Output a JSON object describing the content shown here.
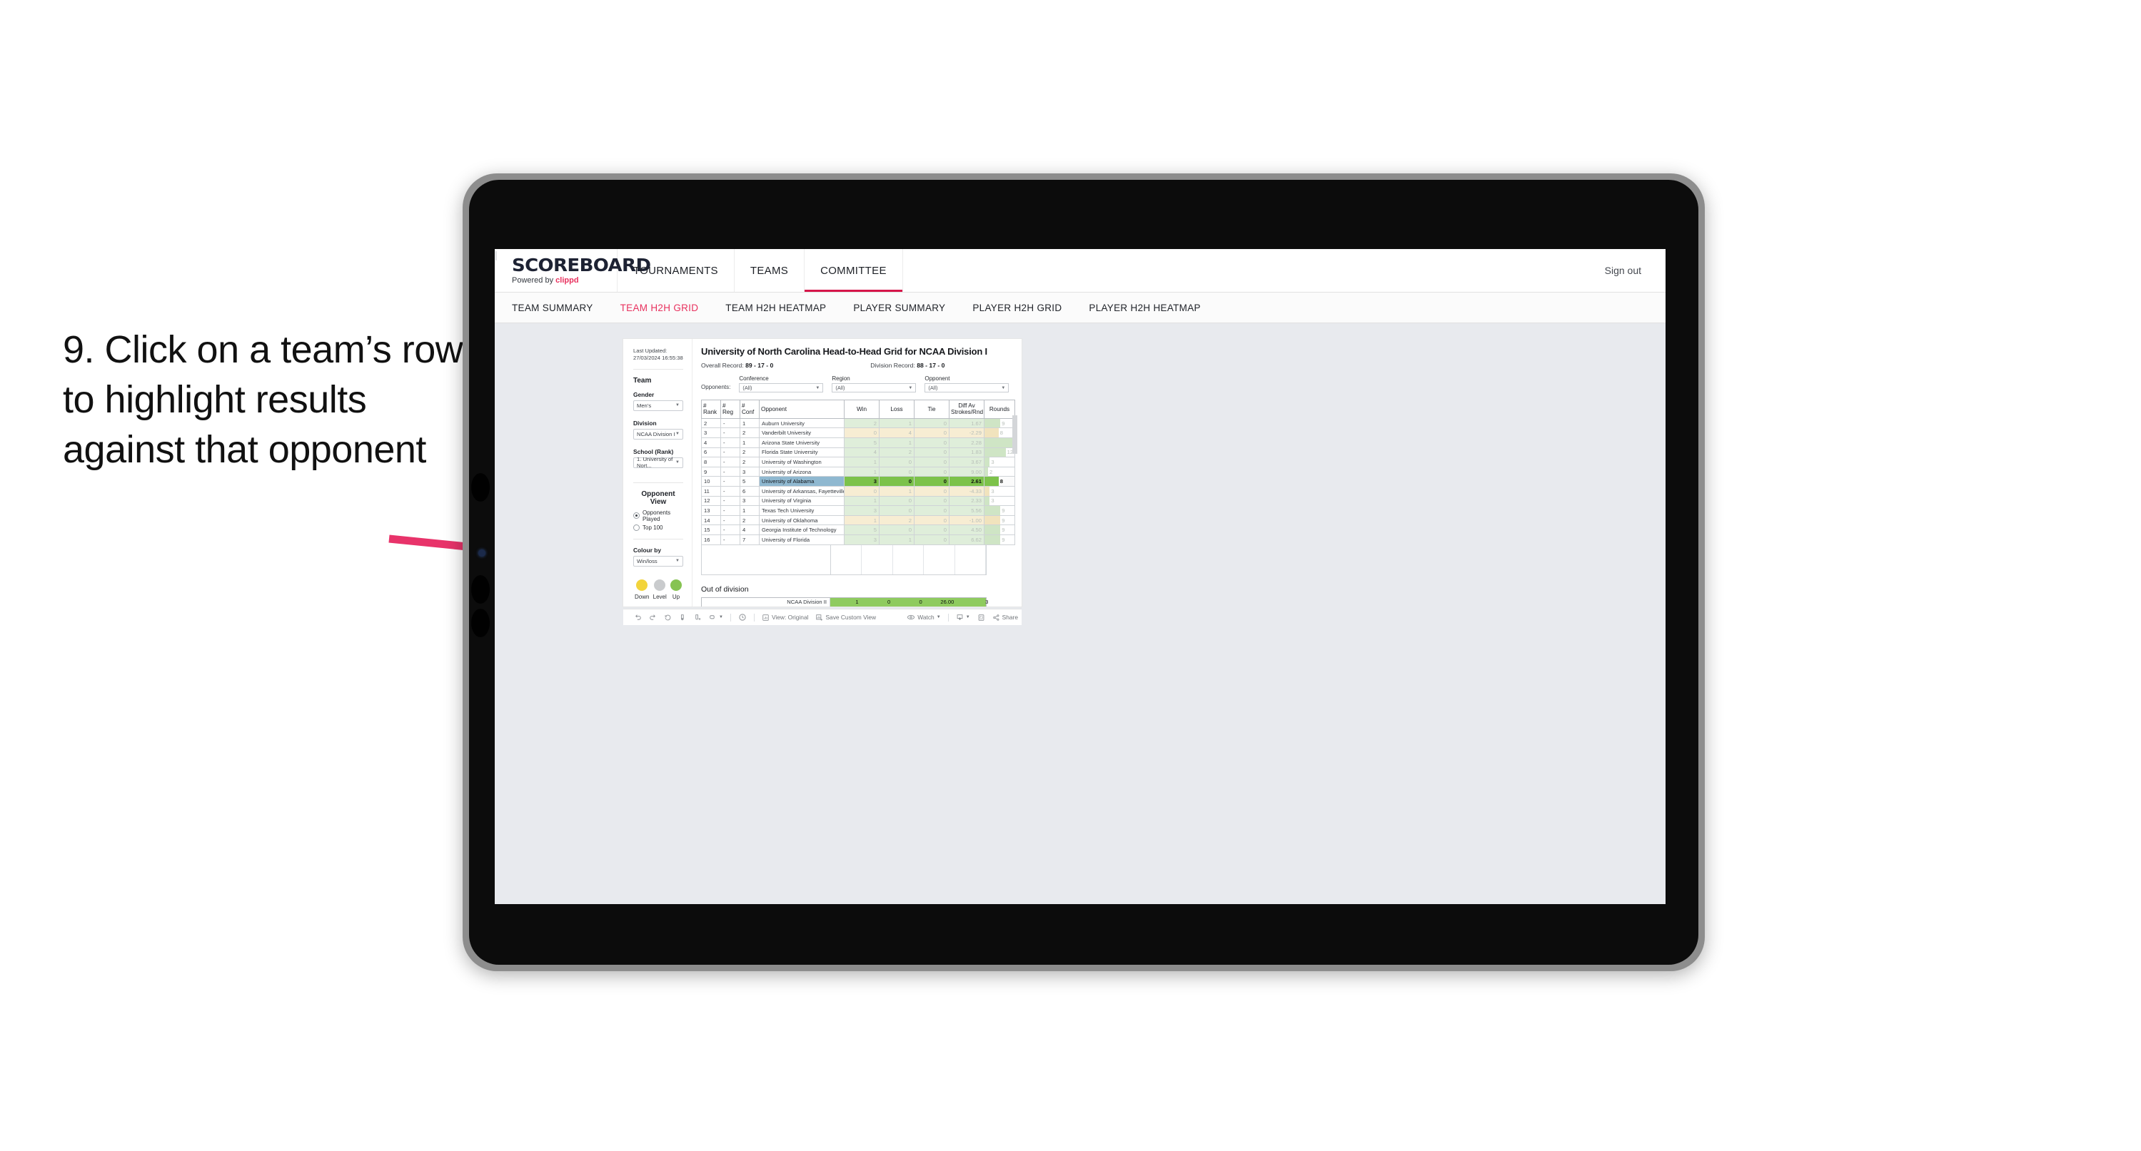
{
  "annotation": {
    "text": "9. Click on a team’s row to highlight results against that opponent",
    "arrow_color": "#e8336a"
  },
  "topnav": {
    "logo_word": "SCOREBOARD",
    "logo_sub_prefix": "Powered by ",
    "logo_sub_brand": "clippd",
    "items": [
      {
        "label": "TOURNAMENTS",
        "active": false
      },
      {
        "label": "TEAMS",
        "active": false
      },
      {
        "label": "COMMITTEE",
        "active": true
      }
    ],
    "divider": "|",
    "signout": "Sign out"
  },
  "subnav": {
    "items": [
      {
        "label": "TEAM SUMMARY",
        "active": false
      },
      {
        "label": "TEAM H2H GRID",
        "active": true
      },
      {
        "label": "TEAM H2H HEATMAP",
        "active": false
      },
      {
        "label": "PLAYER SUMMARY",
        "active": false
      },
      {
        "label": "PLAYER H2H GRID",
        "active": false
      },
      {
        "label": "PLAYER H2H HEATMAP",
        "active": false
      }
    ]
  },
  "sidebar": {
    "last_updated": "Last Updated: 27/03/2024 16:55:38",
    "team_heading": "Team",
    "gender_label": "Gender",
    "gender_value": "Men’s",
    "division_label": "Division",
    "division_value": "NCAA Division I",
    "school_label": "School (Rank)",
    "school_value": "1. University of Nort...",
    "opponent_view_heading": "Opponent View",
    "opponent_view_options": [
      {
        "label": "Opponents Played",
        "selected": true
      },
      {
        "label": "Top 100",
        "selected": false
      }
    ],
    "colour_by_label": "Colour by",
    "colour_by_value": "Win/loss",
    "legend": [
      {
        "label": "Down",
        "color": "#f2d43c"
      },
      {
        "label": "Level",
        "color": "#c9cbcd"
      },
      {
        "label": "Up",
        "color": "#86c352"
      }
    ]
  },
  "main": {
    "title": "University of North Carolina Head-to-Head Grid for NCAA Division I",
    "overall_record_label": "Overall Record: ",
    "overall_record_value": "89 - 17 - 0",
    "division_record_label": "Division Record: ",
    "division_record_value": "88 - 17 - 0",
    "opponents_label": "Opponents:",
    "filters": [
      {
        "label": "Conference",
        "value": "(All)"
      },
      {
        "label": "Region",
        "value": "(All)"
      },
      {
        "label": "Opponent",
        "value": "(All)"
      }
    ],
    "out_of_division_heading": "Out of division"
  },
  "chart_data": {
    "type": "table",
    "title": "University of North Carolina Head-to-Head Grid for NCAA Division I",
    "columns": [
      "# Rank",
      "# Reg",
      "# Conf",
      "Opponent",
      "Win",
      "Loss",
      "Tie",
      "Diff Av Strokes/Rnd",
      "Rounds"
    ],
    "column_headers_multiline": [
      [
        "#",
        "Rank"
      ],
      [
        "#",
        "Reg"
      ],
      [
        "#",
        "Conf"
      ],
      [
        "Opponent"
      ],
      [
        "Win"
      ],
      [
        "Loss"
      ],
      [
        "Tie"
      ],
      [
        "Diff Av",
        "Strokes/Rnd"
      ],
      [
        "Rounds"
      ]
    ],
    "rounds_max": 17,
    "rows": [
      {
        "rank": "2",
        "reg": "-",
        "conf": "1",
        "opponent": "Auburn University",
        "win": "2",
        "loss": "1",
        "tie": "0",
        "diff": "1.67",
        "rounds": 9,
        "tone": "up",
        "selected": false
      },
      {
        "rank": "3",
        "reg": "-",
        "conf": "2",
        "opponent": "Vanderbilt University",
        "win": "0",
        "loss": "4",
        "tie": "0",
        "diff": "-2.29",
        "rounds": 8,
        "tone": "down",
        "selected": false
      },
      {
        "rank": "4",
        "reg": "-",
        "conf": "1",
        "opponent": "Arizona State University",
        "win": "5",
        "loss": "1",
        "tie": "0",
        "diff": "2.28",
        "rounds": 17,
        "tone": "up",
        "selected": false
      },
      {
        "rank": "6",
        "reg": "-",
        "conf": "2",
        "opponent": "Florida State University",
        "win": "4",
        "loss": "2",
        "tie": "0",
        "diff": "1.83",
        "rounds": 12,
        "tone": "up",
        "selected": false
      },
      {
        "rank": "8",
        "reg": "-",
        "conf": "2",
        "opponent": "University of Washington",
        "win": "1",
        "loss": "0",
        "tie": "0",
        "diff": "3.67",
        "rounds": 3,
        "tone": "up",
        "selected": false
      },
      {
        "rank": "9",
        "reg": "-",
        "conf": "3",
        "opponent": "University of Arizona",
        "win": "1",
        "loss": "0",
        "tie": "0",
        "diff": "9.00",
        "rounds": 2,
        "tone": "up",
        "selected": false
      },
      {
        "rank": "10",
        "reg": "-",
        "conf": "5",
        "opponent": "University of Alabama",
        "win": "3",
        "loss": "0",
        "tie": "0",
        "diff": "2.61",
        "rounds": 8,
        "tone": "up",
        "selected": true
      },
      {
        "rank": "11",
        "reg": "-",
        "conf": "6",
        "opponent": "University of Arkansas, Fayetteville",
        "win": "0",
        "loss": "1",
        "tie": "0",
        "diff": "-4.33",
        "rounds": 3,
        "tone": "down",
        "selected": false
      },
      {
        "rank": "12",
        "reg": "-",
        "conf": "3",
        "opponent": "University of Virginia",
        "win": "1",
        "loss": "0",
        "tie": "0",
        "diff": "2.33",
        "rounds": 3,
        "tone": "up",
        "selected": false
      },
      {
        "rank": "13",
        "reg": "-",
        "conf": "1",
        "opponent": "Texas Tech University",
        "win": "3",
        "loss": "0",
        "tie": "0",
        "diff": "5.56",
        "rounds": 9,
        "tone": "up",
        "selected": false
      },
      {
        "rank": "14",
        "reg": "-",
        "conf": "2",
        "opponent": "University of Oklahoma",
        "win": "1",
        "loss": "2",
        "tie": "0",
        "diff": "-1.00",
        "rounds": 9,
        "tone": "down",
        "selected": false
      },
      {
        "rank": "15",
        "reg": "-",
        "conf": "4",
        "opponent": "Georgia Institute of Technology",
        "win": "5",
        "loss": "0",
        "tie": "0",
        "diff": "4.50",
        "rounds": 9,
        "tone": "up",
        "selected": false
      },
      {
        "rank": "16",
        "reg": "-",
        "conf": "7",
        "opponent": "University of Florida",
        "win": "3",
        "loss": "1",
        "tie": "0",
        "diff": "6.62",
        "rounds": 9,
        "tone": "up",
        "selected": false
      }
    ],
    "out_of_division": {
      "label": "NCAA Division II",
      "win": "1",
      "loss": "0",
      "tie": "0",
      "diff": "26.00",
      "rounds": "3"
    }
  },
  "toolbar": {
    "items": [
      {
        "name": "undo",
        "label": ""
      },
      {
        "name": "redo",
        "label": ""
      },
      {
        "name": "revert",
        "label": ""
      },
      {
        "name": "refresh",
        "label": ""
      },
      {
        "name": "pause",
        "label": ""
      },
      {
        "name": "alerts",
        "label": ""
      },
      {
        "name": "view-original",
        "label": "View: Original"
      },
      {
        "name": "save-custom-view",
        "label": "Save Custom View"
      },
      {
        "name": "watch",
        "label": "Watch"
      },
      {
        "name": "download",
        "label": ""
      },
      {
        "name": "fullscreen",
        "label": ""
      },
      {
        "name": "share",
        "label": "Share"
      }
    ],
    "view_original": "View: Original",
    "save_custom_view": "Save Custom View",
    "watch": "Watch",
    "share": "Share"
  }
}
